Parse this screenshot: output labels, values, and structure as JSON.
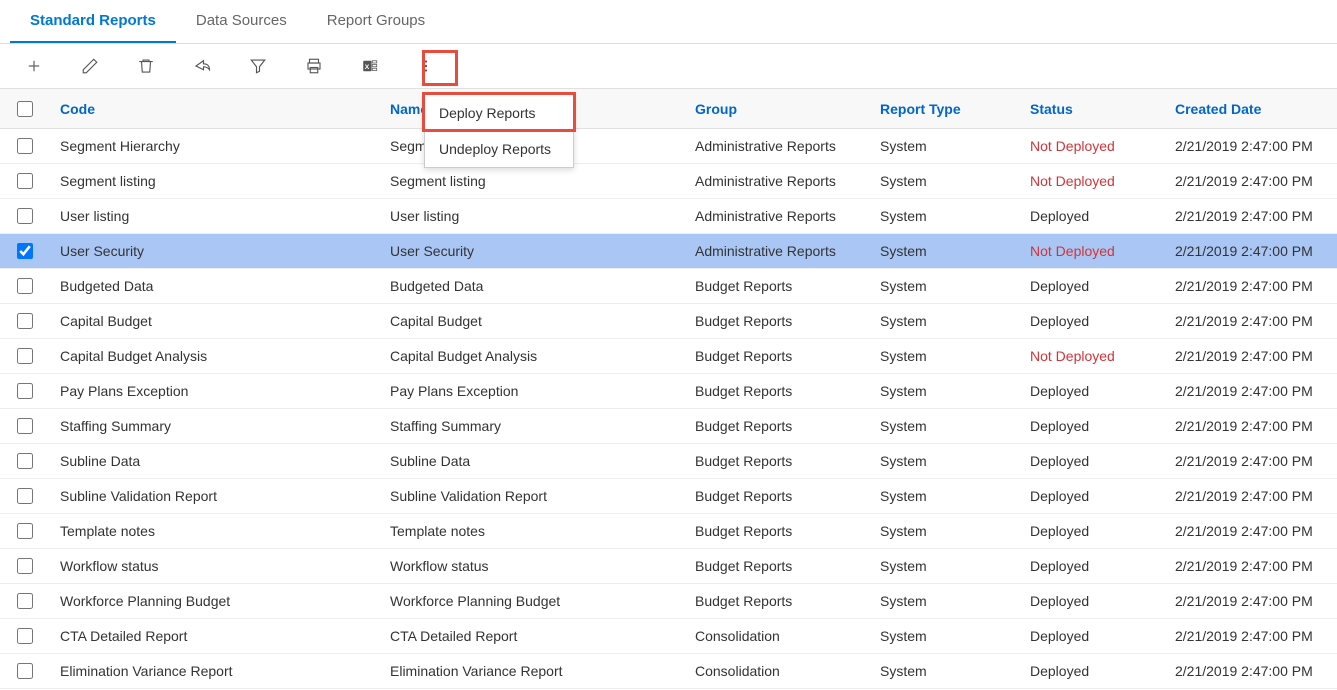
{
  "tabs": [
    {
      "label": "Standard Reports",
      "active": true
    },
    {
      "label": "Data Sources",
      "active": false
    },
    {
      "label": "Report Groups",
      "active": false
    }
  ],
  "toolbar": {
    "icons": [
      "add",
      "edit",
      "delete",
      "share",
      "filter",
      "print",
      "excel",
      "more"
    ]
  },
  "dropdown": {
    "items": [
      {
        "label": "Deploy Reports"
      },
      {
        "label": "Undeploy Reports"
      }
    ]
  },
  "columns": {
    "code": "Code",
    "name": "Name",
    "group": "Group",
    "type": "Report Type",
    "status": "Status",
    "date": "Created Date"
  },
  "rows": [
    {
      "checked": false,
      "code": "Segment Hierarchy",
      "name": "Segment Hierarchy",
      "group": "Administrative Reports",
      "type": "System",
      "status": "Not Deployed",
      "date": "2/21/2019 2:47:00 PM",
      "selected": false
    },
    {
      "checked": false,
      "code": "Segment listing",
      "name": "Segment listing",
      "group": "Administrative Reports",
      "type": "System",
      "status": "Not Deployed",
      "date": "2/21/2019 2:47:00 PM",
      "selected": false
    },
    {
      "checked": false,
      "code": "User listing",
      "name": "User listing",
      "group": "Administrative Reports",
      "type": "System",
      "status": "Deployed",
      "date": "2/21/2019 2:47:00 PM",
      "selected": false
    },
    {
      "checked": true,
      "code": "User Security",
      "name": "User Security",
      "group": "Administrative Reports",
      "type": "System",
      "status": "Not Deployed",
      "date": "2/21/2019 2:47:00 PM",
      "selected": true
    },
    {
      "checked": false,
      "code": "Budgeted Data",
      "name": "Budgeted Data",
      "group": "Budget Reports",
      "type": "System",
      "status": "Deployed",
      "date": "2/21/2019 2:47:00 PM",
      "selected": false
    },
    {
      "checked": false,
      "code": "Capital Budget",
      "name": "Capital Budget",
      "group": "Budget Reports",
      "type": "System",
      "status": "Deployed",
      "date": "2/21/2019 2:47:00 PM",
      "selected": false
    },
    {
      "checked": false,
      "code": "Capital Budget Analysis",
      "name": "Capital Budget Analysis",
      "group": "Budget Reports",
      "type": "System",
      "status": "Not Deployed",
      "date": "2/21/2019 2:47:00 PM",
      "selected": false
    },
    {
      "checked": false,
      "code": "Pay Plans Exception",
      "name": "Pay Plans Exception",
      "group": "Budget Reports",
      "type": "System",
      "status": "Deployed",
      "date": "2/21/2019 2:47:00 PM",
      "selected": false
    },
    {
      "checked": false,
      "code": "Staffing Summary",
      "name": "Staffing Summary",
      "group": "Budget Reports",
      "type": "System",
      "status": "Deployed",
      "date": "2/21/2019 2:47:00 PM",
      "selected": false
    },
    {
      "checked": false,
      "code": "Subline Data",
      "name": "Subline Data",
      "group": "Budget Reports",
      "type": "System",
      "status": "Deployed",
      "date": "2/21/2019 2:47:00 PM",
      "selected": false
    },
    {
      "checked": false,
      "code": "Subline Validation Report",
      "name": "Subline Validation Report",
      "group": "Budget Reports",
      "type": "System",
      "status": "Deployed",
      "date": "2/21/2019 2:47:00 PM",
      "selected": false
    },
    {
      "checked": false,
      "code": "Template notes",
      "name": "Template notes",
      "group": "Budget Reports",
      "type": "System",
      "status": "Deployed",
      "date": "2/21/2019 2:47:00 PM",
      "selected": false
    },
    {
      "checked": false,
      "code": "Workflow status",
      "name": "Workflow status",
      "group": "Budget Reports",
      "type": "System",
      "status": "Deployed",
      "date": "2/21/2019 2:47:00 PM",
      "selected": false
    },
    {
      "checked": false,
      "code": "Workforce Planning Budget",
      "name": "Workforce Planning Budget",
      "group": "Budget Reports",
      "type": "System",
      "status": "Deployed",
      "date": "2/21/2019 2:47:00 PM",
      "selected": false
    },
    {
      "checked": false,
      "code": "CTA Detailed Report",
      "name": "CTA Detailed Report",
      "group": "Consolidation",
      "type": "System",
      "status": "Deployed",
      "date": "2/21/2019 2:47:00 PM",
      "selected": false
    },
    {
      "checked": false,
      "code": "Elimination Variance Report",
      "name": "Elimination Variance Report",
      "group": "Consolidation",
      "type": "System",
      "status": "Deployed",
      "date": "2/21/2019 2:47:00 PM",
      "selected": false
    }
  ]
}
